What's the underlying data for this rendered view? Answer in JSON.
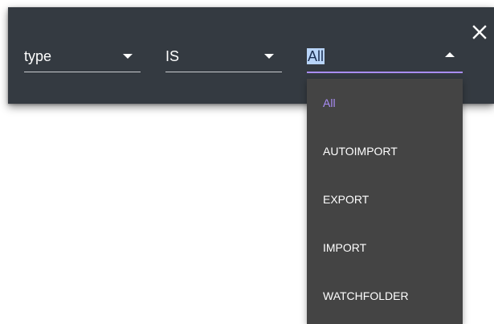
{
  "filter": {
    "field": {
      "value": "type"
    },
    "operator": {
      "value": "IS"
    },
    "value": {
      "selected": "All",
      "options": [
        "All",
        "AUTOIMPORT",
        "EXPORT",
        "IMPORT",
        "WATCHFOLDER"
      ]
    }
  },
  "icons": {
    "close": "close-icon",
    "dropdown": "caret-down-icon",
    "dropdown_open": "caret-up-icon"
  },
  "colors": {
    "bar_background": "#343a41",
    "menu_background": "#444444",
    "accent": "#a98df5",
    "text": "#ffffff"
  }
}
